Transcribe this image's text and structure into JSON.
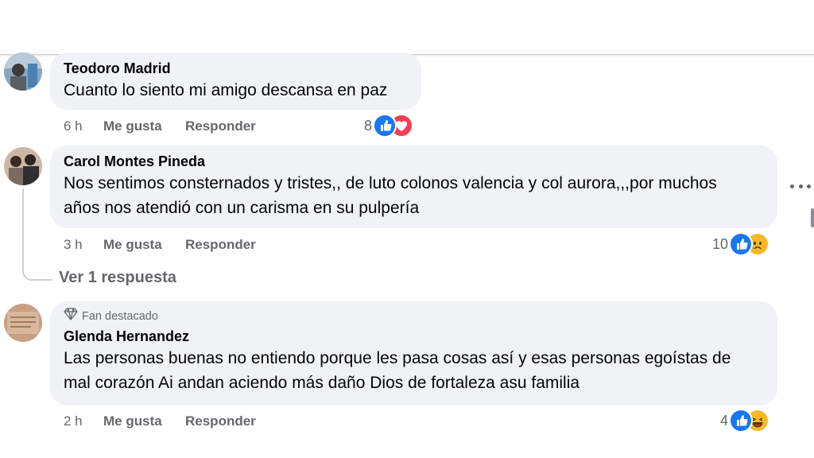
{
  "comments": [
    {
      "author": "Teodoro Madrid",
      "text": "Cuanto lo siento mi amigo descansa en paz",
      "time": "6 h",
      "like_label": "Me gusta",
      "reply_label": "Responder",
      "reaction_count": "8",
      "reactions": [
        "like-icon",
        "love-icon"
      ]
    },
    {
      "author": "Carol Montes Pineda",
      "text_line1": "Nos sentimos consternados y tristes,, de luto colonos valencia y col aurora,,,por muchos",
      "text_line2": "años nos atendió con un carisma en su pulpería",
      "time": "3 h",
      "like_label": "Me gusta",
      "reply_label": "Responder",
      "reaction_count": "10",
      "reactions": [
        "like-icon",
        "sad-icon"
      ],
      "view_replies": "Ver 1 respuesta"
    },
    {
      "badge": "Fan destacado",
      "author": "Glenda Hernandez",
      "text_line1": "Las personas buenas no entiendo porque les pasa cosas así y esas personas egoístas de",
      "text_line2": "mal corazón Ai andan aciendo más daño Dios de fortaleza asu familia",
      "time": "2 h",
      "like_label": "Me gusta",
      "reply_label": "Responder",
      "reaction_count": "4",
      "reactions": [
        "like-icon",
        "haha-icon"
      ]
    }
  ],
  "colors": {
    "bubble": "#f0f2f5",
    "secondary_text": "#65676b",
    "like_blue": "#1877f2",
    "love_red": "#f33e58",
    "emoji_yellow": "#f7b928"
  }
}
